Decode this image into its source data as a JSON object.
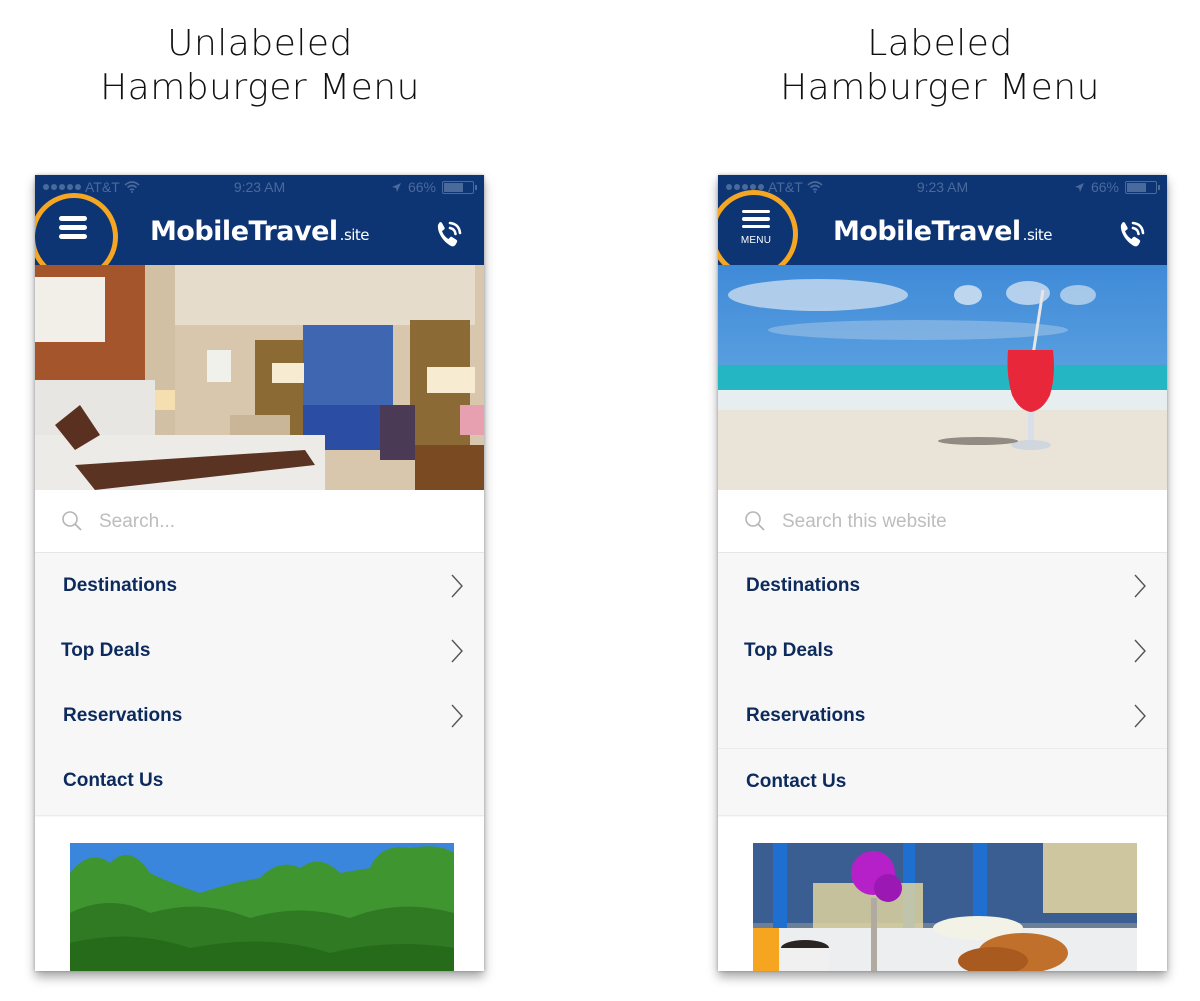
{
  "captions": {
    "left": {
      "line1": "Unlabeled",
      "line2": "Hamburger Menu"
    },
    "right": {
      "line1": "Labeled",
      "line2": "Hamburger Menu"
    }
  },
  "phones": {
    "left": {
      "status": {
        "carrier": "AT&T",
        "time": "9:23 AM",
        "battery": "66%",
        "battery_level": 0.66
      },
      "brand": {
        "name": "MobileTravel",
        "tld": ".site"
      },
      "hamburger": {
        "label": ""
      },
      "hero_image": "hotel-room",
      "search": {
        "placeholder": "Search..."
      },
      "menu": [
        {
          "label": "Destinations",
          "has_chevron": true
        },
        {
          "label": "Top Deals",
          "has_chevron": true
        },
        {
          "label": "Reservations",
          "has_chevron": true
        },
        {
          "label": "Contact Us",
          "has_chevron": false
        }
      ],
      "promo_image": "rainforest"
    },
    "right": {
      "status": {
        "carrier": "AT&T",
        "time": "9:23 AM",
        "battery": "66%",
        "battery_level": 0.66
      },
      "brand": {
        "name": "MobileTravel",
        "tld": ".site"
      },
      "hamburger": {
        "label": "MENU"
      },
      "hero_image": "beach-cocktail",
      "search": {
        "placeholder": "Search this website"
      },
      "menu": [
        {
          "label": "Destinations",
          "has_chevron": true
        },
        {
          "label": "Top Deals",
          "has_chevron": true
        },
        {
          "label": "Reservations",
          "has_chevron": true
        },
        {
          "label": "Contact Us",
          "has_chevron": false
        }
      ],
      "promo_image": "breakfast-table"
    }
  },
  "colors": {
    "navbar": "#0d3473",
    "highlight": "#f5a623",
    "menu_text": "#0d2a5c"
  }
}
